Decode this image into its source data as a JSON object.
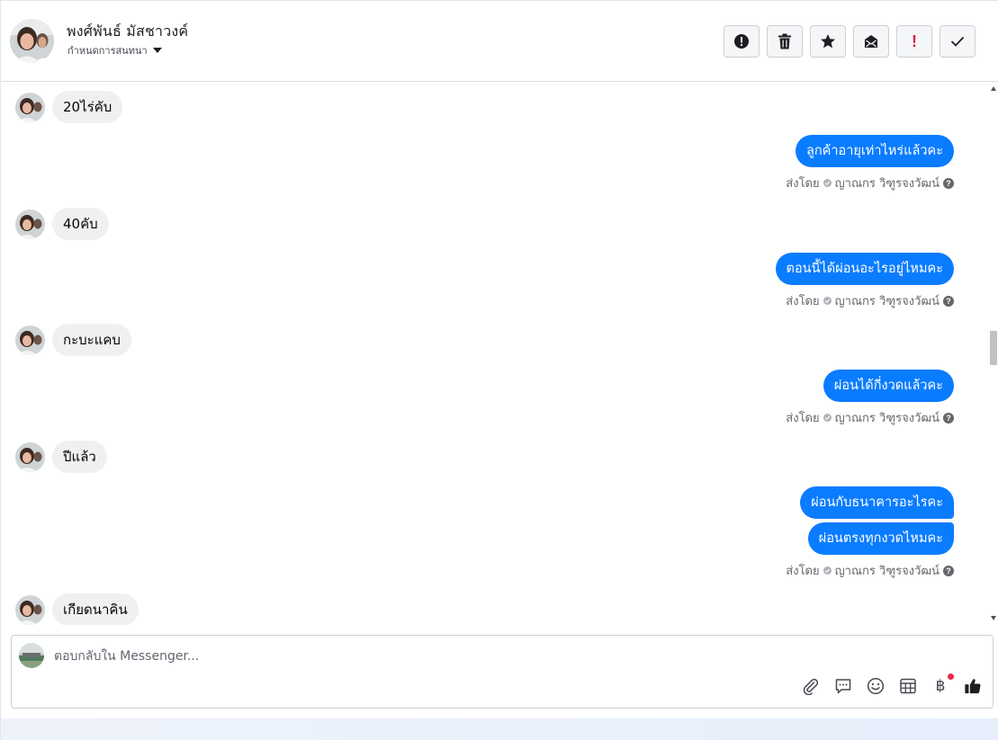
{
  "header": {
    "contact_name": "พงศ์พันธ์ มัสชาวงค์",
    "conversation_status": "กำหนดการสนทนา",
    "actions": [
      {
        "name": "mark-spam-button",
        "icon": "alert-circle-icon"
      },
      {
        "name": "delete-button",
        "icon": "trash-icon"
      },
      {
        "name": "star-button",
        "icon": "star-icon"
      },
      {
        "name": "mark-unread-button",
        "icon": "envelope-icon"
      },
      {
        "name": "follow-up-button",
        "icon": "exclamation-icon",
        "label": "!"
      },
      {
        "name": "mark-done-button",
        "icon": "check-icon"
      }
    ]
  },
  "messages": {
    "incoming": [
      {
        "text": "20ไร่คับ"
      },
      {
        "text": "40คับ"
      },
      {
        "text": "กะบะแคบ"
      },
      {
        "text": "ปีแล้ว"
      },
      {
        "text": "เกียดนาคิน"
      }
    ],
    "outgoing": [
      {
        "texts": [
          "ลูกค้าอายุเท่าไหร่แล้วคะ"
        ],
        "sent_by_label": "ส่งโดย",
        "sender": "ญาณกร วิฑูรจงวัฒน์"
      },
      {
        "texts": [
          "ตอนนี้ได้ผ่อนอะไรอยู่ไหมคะ"
        ],
        "sent_by_label": "ส่งโดย",
        "sender": "ญาณกร วิฑูรจงวัฒน์"
      },
      {
        "texts": [
          "ผ่อนได้กี่งวดแล้วคะ"
        ],
        "sent_by_label": "ส่งโดย",
        "sender": "ญาณกร วิฑูรจงวัฒน์"
      },
      {
        "texts": [
          "ผ่อนกับธนาคารอะไรคะ",
          "ผ่อนตรงทุกงวดไหมคะ"
        ],
        "sent_by_label": "ส่งโดย",
        "sender": "ญาณกร วิฑูรจงวัฒน์"
      }
    ]
  },
  "composer": {
    "placeholder": "ตอบกลับใน Messenger...",
    "value": "",
    "tools": [
      "paperclip-icon",
      "saved-reply-icon",
      "emoji-icon",
      "appointment-icon",
      "baht-payment-icon",
      "thumbs-up-icon"
    ],
    "baht_symbol": "฿"
  },
  "colors": {
    "outgoing_bubble": "#0a7cff",
    "incoming_bubble": "#f0f0f0",
    "alert_red": "#e41e3f"
  }
}
